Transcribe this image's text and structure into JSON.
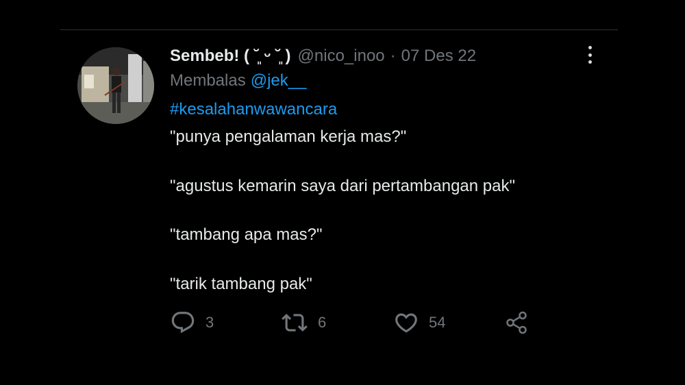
{
  "tweet": {
    "display_name": "Sembeb! ( ˘͈ ᵕ ˘͈ )",
    "handle": "@nico_inoo",
    "separator": "·",
    "date": "07 Des 22",
    "reply_prefix": "Membalas",
    "reply_to": "@jek__",
    "hashtag": "#kesalahanwawancara",
    "lines": [
      "\"punya pengalaman kerja mas?\"",
      "\"agustus kemarin saya dari pertambangan pak\"",
      "\"tambang apa mas?\"",
      "\"tarik tambang pak\""
    ]
  },
  "actions": {
    "reply": {
      "icon": "reply-icon",
      "count": "3"
    },
    "retweet": {
      "icon": "retweet-icon",
      "count": "6"
    },
    "like": {
      "icon": "heart-icon",
      "count": "54"
    },
    "share": {
      "icon": "share-icon"
    }
  },
  "colors": {
    "background": "#000000",
    "text": "#e7e9ea",
    "muted": "#71767b",
    "link": "#1d9bf0",
    "divider": "#2f3336"
  }
}
